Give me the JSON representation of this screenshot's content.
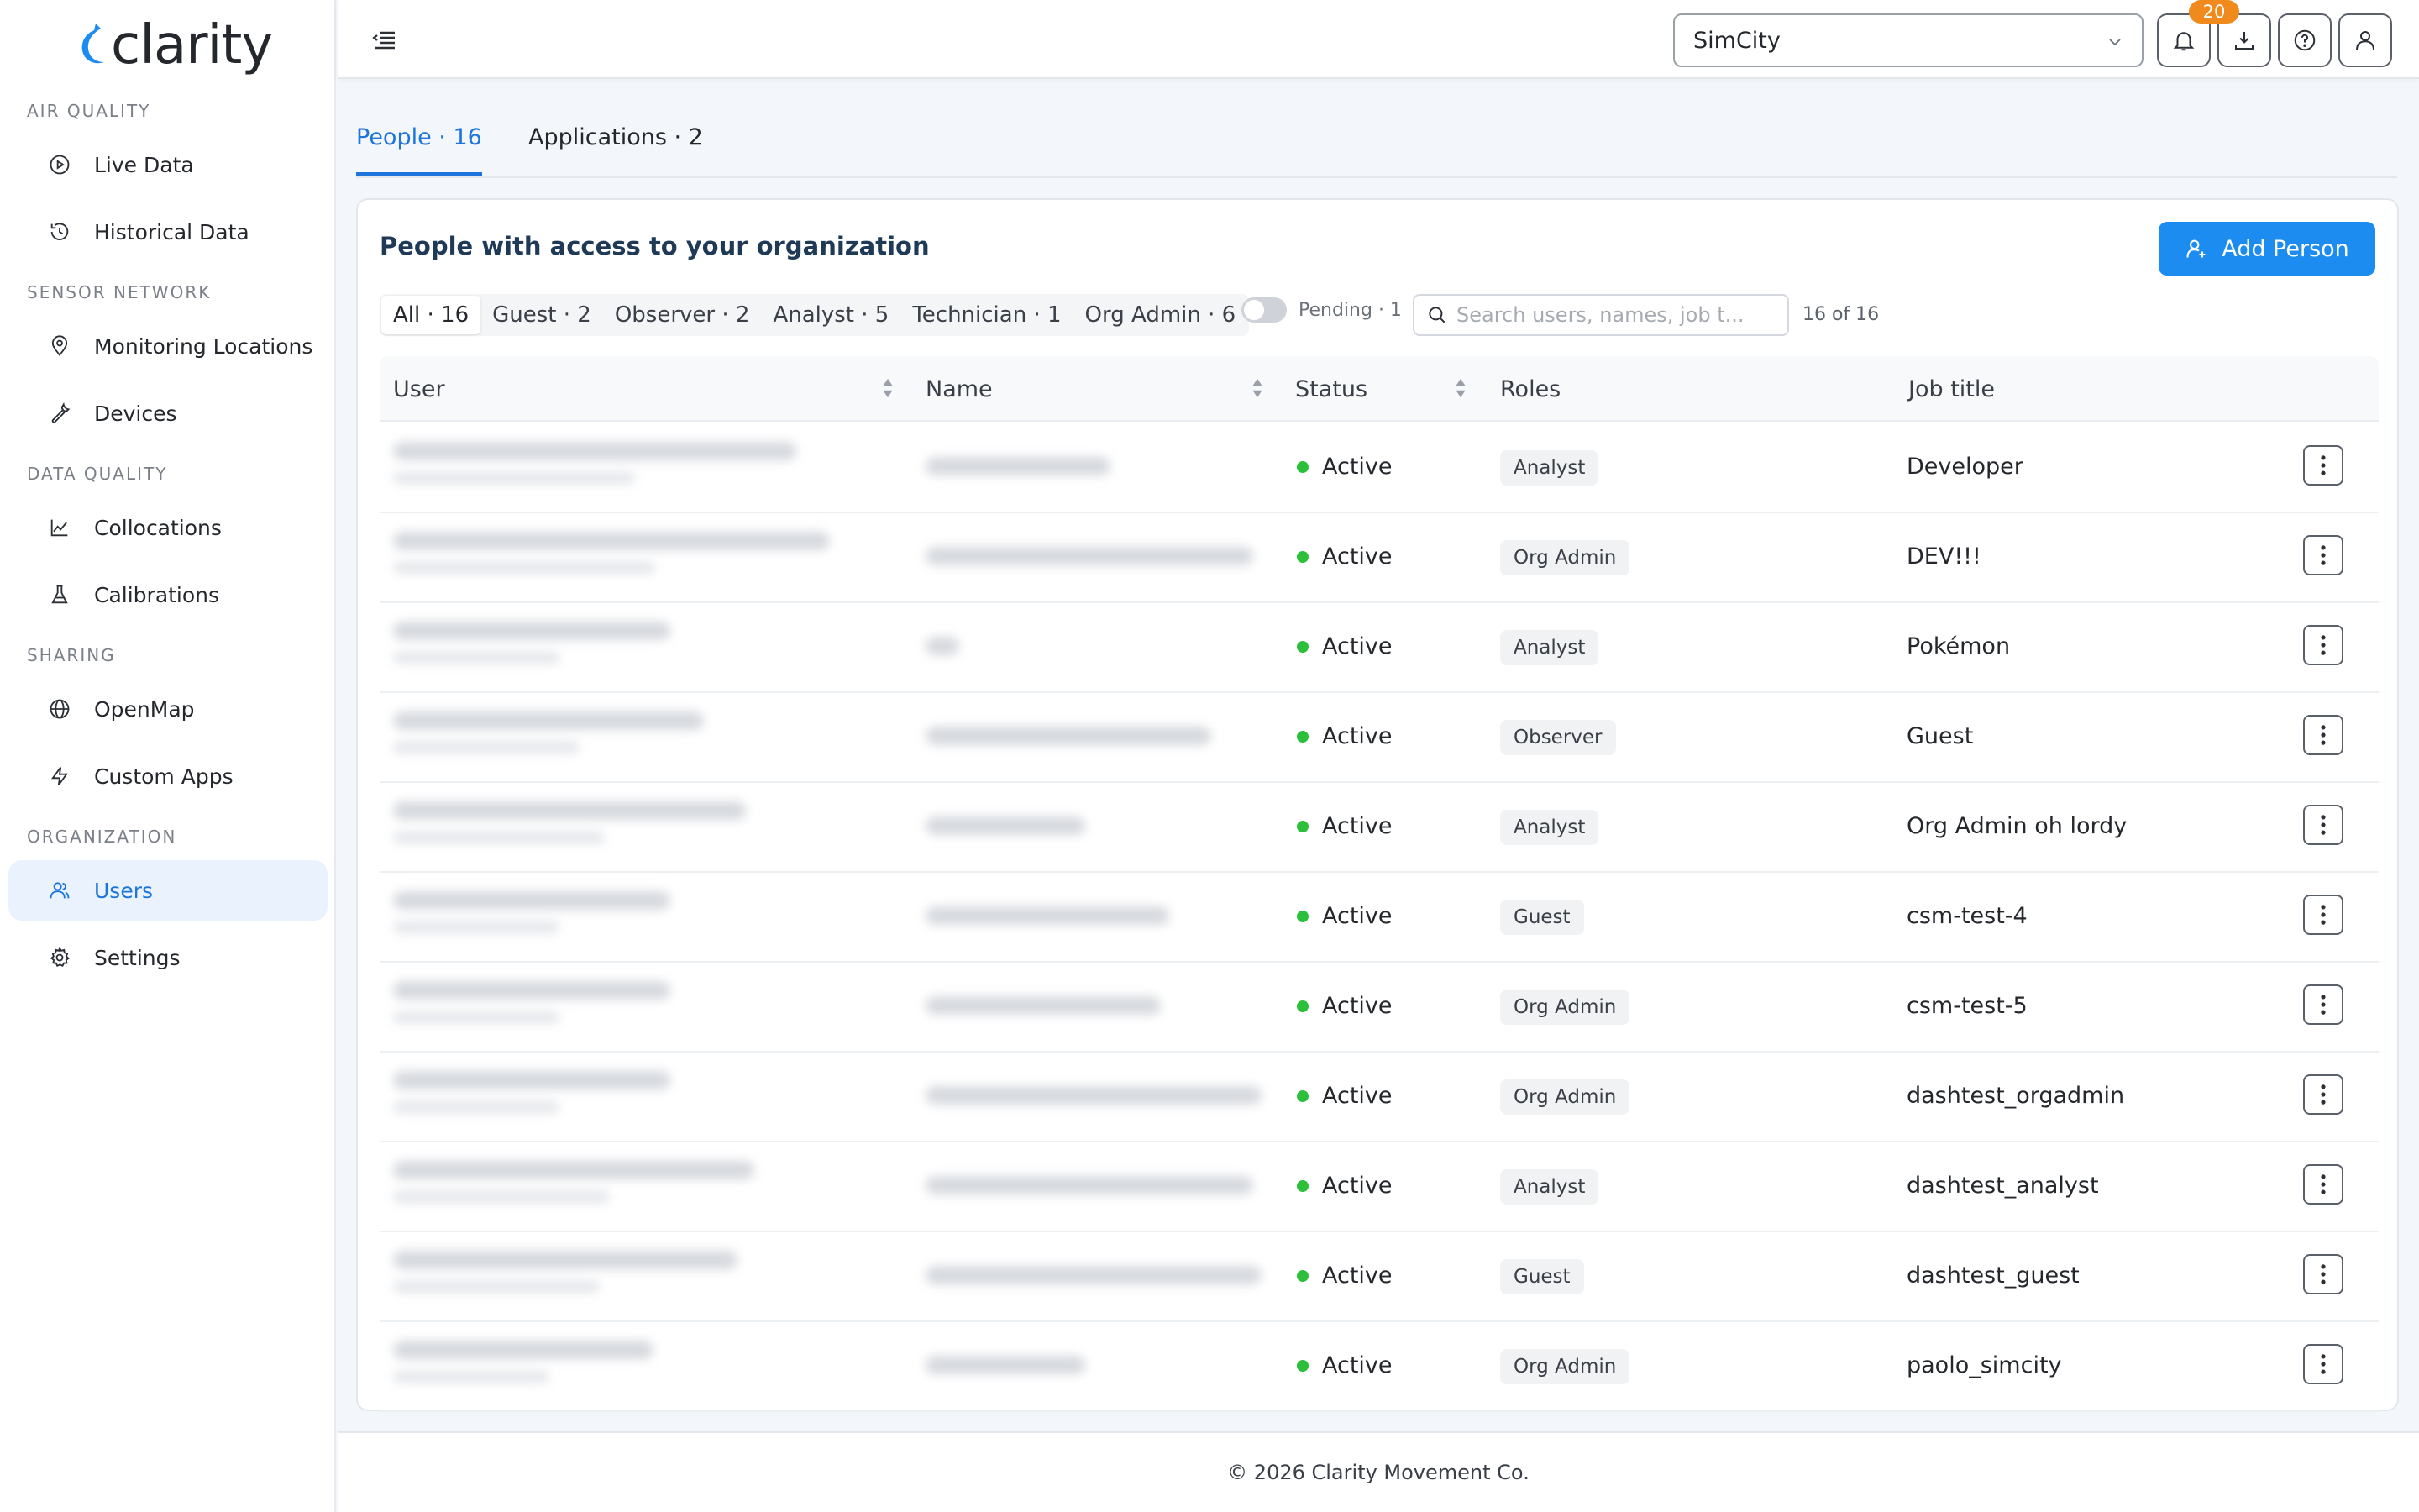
{
  "brand": {
    "name": "clarity",
    "accent": "#1d74db"
  },
  "sidebar": {
    "sections": [
      {
        "label": "AIR QUALITY",
        "items": [
          {
            "label": "Live Data",
            "icon": "play-circle-icon"
          },
          {
            "label": "Historical Data",
            "icon": "history-icon"
          }
        ]
      },
      {
        "label": "SENSOR NETWORK",
        "items": [
          {
            "label": "Monitoring Locations",
            "icon": "location-pin-icon"
          },
          {
            "label": "Devices",
            "icon": "wrench-icon"
          }
        ]
      },
      {
        "label": "DATA QUALITY",
        "items": [
          {
            "label": "Collocations",
            "icon": "line-chart-icon"
          },
          {
            "label": "Calibrations",
            "icon": "flask-icon"
          }
        ]
      },
      {
        "label": "SHARING",
        "items": [
          {
            "label": "OpenMap",
            "icon": "globe-icon"
          },
          {
            "label": "Custom Apps",
            "icon": "lightning-icon"
          }
        ]
      },
      {
        "label": "ORGANIZATION",
        "items": [
          {
            "label": "Users",
            "icon": "users-icon",
            "active": true
          },
          {
            "label": "Settings",
            "icon": "gear-icon"
          }
        ]
      }
    ]
  },
  "topbar": {
    "org_select": "SimCity",
    "notifications_count": "20"
  },
  "tabs": [
    {
      "label": "People · 16",
      "active": true
    },
    {
      "label": "Applications · 2"
    }
  ],
  "card": {
    "title": "People with access to your organization",
    "add_button": "Add Person",
    "filters": [
      "All · 16",
      "Guest · 2",
      "Observer · 2",
      "Analyst · 5",
      "Technician · 1",
      "Org Admin · 6"
    ],
    "pending_label": "Pending · 1",
    "search_placeholder": "Search users, names, job t...",
    "count": "16 of 16"
  },
  "table": {
    "columns": [
      "User",
      "Name",
      "Status",
      "Roles",
      "Job title"
    ],
    "rows": [
      {
        "status": "Active",
        "role": "Analyst",
        "job": "Developer"
      },
      {
        "status": "Active",
        "role": "Org Admin",
        "job": "DEV!!!"
      },
      {
        "status": "Active",
        "role": "Analyst",
        "job": "Pokémon"
      },
      {
        "status": "Active",
        "role": "Observer",
        "job": "Guest"
      },
      {
        "status": "Active",
        "role": "Analyst",
        "job": "Org Admin oh lordy"
      },
      {
        "status": "Active",
        "role": "Guest",
        "job": "csm-test-4"
      },
      {
        "status": "Active",
        "role": "Org Admin",
        "job": "csm-test-5"
      },
      {
        "status": "Active",
        "role": "Org Admin",
        "job": "dashtest_orgadmin"
      },
      {
        "status": "Active",
        "role": "Analyst",
        "job": "dashtest_analyst"
      },
      {
        "status": "Active",
        "role": "Guest",
        "job": "dashtest_guest"
      },
      {
        "status": "Active",
        "role": "Org Admin",
        "job": "paolo_simcity"
      }
    ]
  },
  "footer": {
    "text": "© 2026 Clarity Movement Co."
  },
  "colors": {
    "active_status": "#2bbf3a",
    "primary_button": "#1d8cf0",
    "badge": "#f08a1c"
  }
}
